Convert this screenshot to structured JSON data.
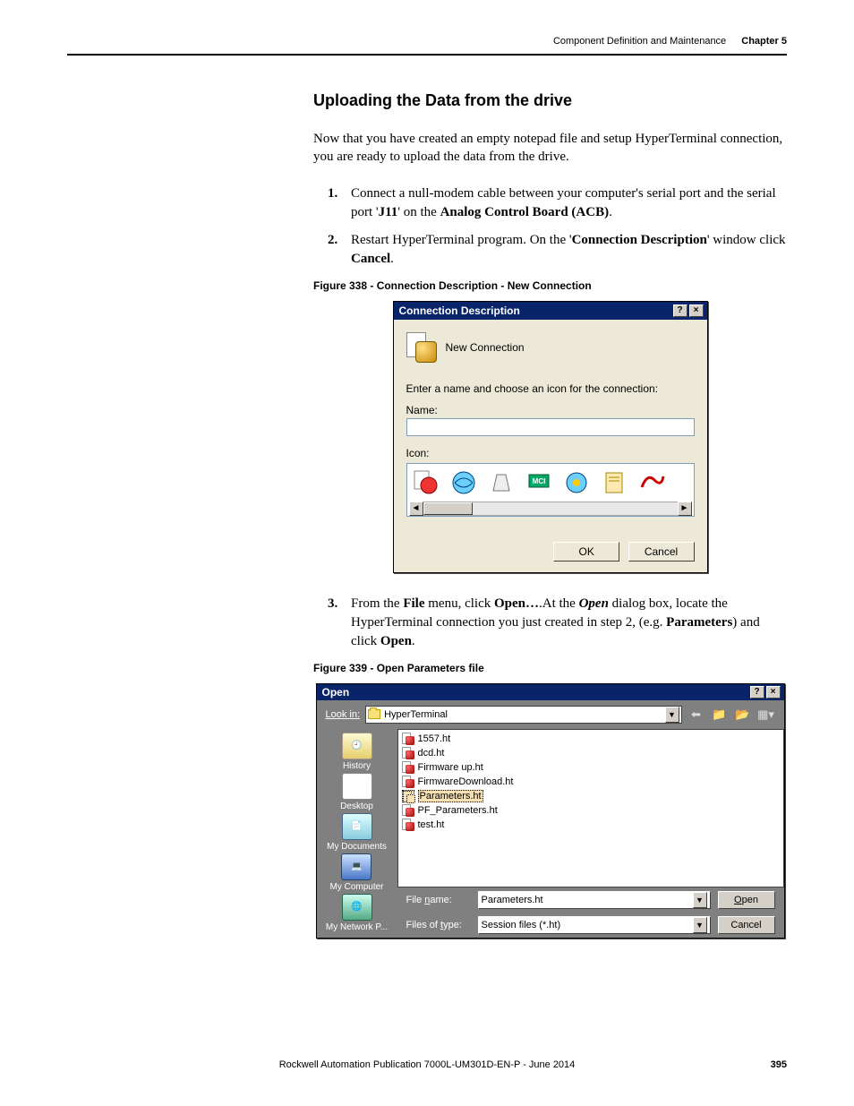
{
  "header": {
    "chapter_title": "Component Definition and Maintenance",
    "chapter_num": "Chapter 5"
  },
  "section_title": "Uploading the Data from the drive",
  "intro": "Now that you have created an empty notepad file and setup HyperTerminal connection, you are ready to upload the data from the drive.",
  "steps": {
    "s1_a": "Connect a null-modem cable between your computer's serial port and the serial port '",
    "s1_b": "J11",
    "s1_c": "' on the ",
    "s1_d": "Analog Control Board (ACB)",
    "s1_e": ".",
    "s2_a": "Restart HyperTerminal program. On the '",
    "s2_b": "Connection Description",
    "s2_c": "' window click ",
    "s2_d": "Cancel",
    "s2_e": ".",
    "s3_a": "From the ",
    "s3_b": "File",
    "s3_c": " menu, click ",
    "s3_d": "Open…",
    "s3_e": ".At the ",
    "s3_f": "Open",
    "s3_g": " dialog box, locate the HyperTerminal connection you just created in step 2, (e.g. ",
    "s3_h": "Parameters",
    "s3_i": ") and click ",
    "s3_j": "Open",
    "s3_k": "."
  },
  "fig338_caption": "Figure 338 - Connection Description - New Connection",
  "fig339_caption": "Figure 339 - Open Parameters file",
  "dlg1": {
    "title": "Connection Description",
    "newconn": "New Connection",
    "prompt": "Enter a name and choose an icon for the connection:",
    "name_label": "Name:",
    "name_value": "",
    "icon_label": "Icon:",
    "ok": "OK",
    "cancel": "Cancel"
  },
  "dlg2": {
    "title": "Open",
    "lookin_label": "Look in:",
    "lookin_value": "HyperTerminal",
    "places": {
      "history": "History",
      "desktop": "Desktop",
      "mydocs": "My Documents",
      "mycomp": "My Computer",
      "mynet": "My Network P..."
    },
    "files": [
      "1557.ht",
      "dcd.ht",
      "Firmware up.ht",
      "FirmwareDownload.ht",
      "Parameters.ht",
      "PF_Parameters.ht",
      "test.ht"
    ],
    "selected_index": 4,
    "filename_label": "File name:",
    "filename_value": "Parameters.ht",
    "filetype_label": "Files of type:",
    "filetype_value": "Session files (*.ht)",
    "open": "Open",
    "cancel": "Cancel"
  },
  "footer": {
    "pub": "Rockwell Automation Publication 7000L-UM301D-EN-P - June 2014",
    "page": "395"
  }
}
